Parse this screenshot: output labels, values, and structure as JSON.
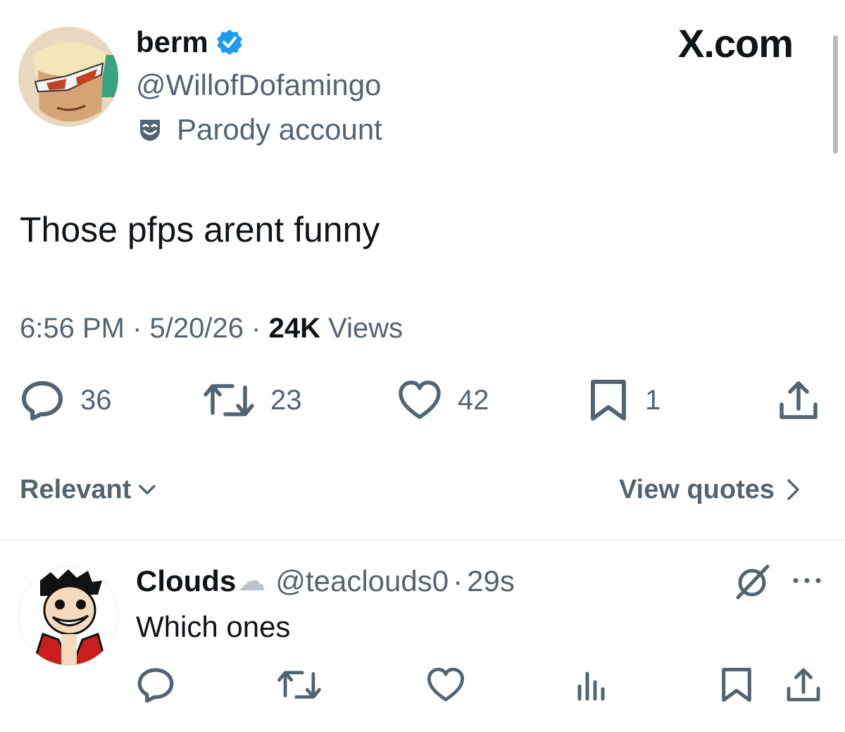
{
  "tweet": {
    "author_name": "berm",
    "author_handle": "@WillofDofamingo",
    "parody_label": "Parody account",
    "text": "Those pfps arent funny",
    "time": "6:56 PM",
    "sep1": "·",
    "date": "5/20/26",
    "sep2": "·",
    "views_count": "24K",
    "views_label": "Views",
    "counts": {
      "replies": "36",
      "reposts": "23",
      "likes": "42",
      "bookmarks": "1"
    }
  },
  "brand": {
    "site": "X.com"
  },
  "controls": {
    "sort_label": "Relevant",
    "view_quotes_label": "View quotes"
  },
  "reply": {
    "author_name": "Clouds",
    "emoji": "☁",
    "author_handle": "@teaclouds0",
    "sep": "·",
    "time": "29s",
    "text": "Which ones"
  },
  "icons": [
    "verified-badge-icon",
    "parody-mask-icon",
    "reply-icon",
    "repost-icon",
    "like-icon",
    "bookmark-icon",
    "share-icon",
    "chevron-down-icon",
    "chevron-right-icon",
    "grok-icon",
    "more-icon",
    "views-icon"
  ],
  "colors": {
    "verified": "#1d9bf0",
    "text": "#0f1419",
    "muted": "#536471"
  }
}
